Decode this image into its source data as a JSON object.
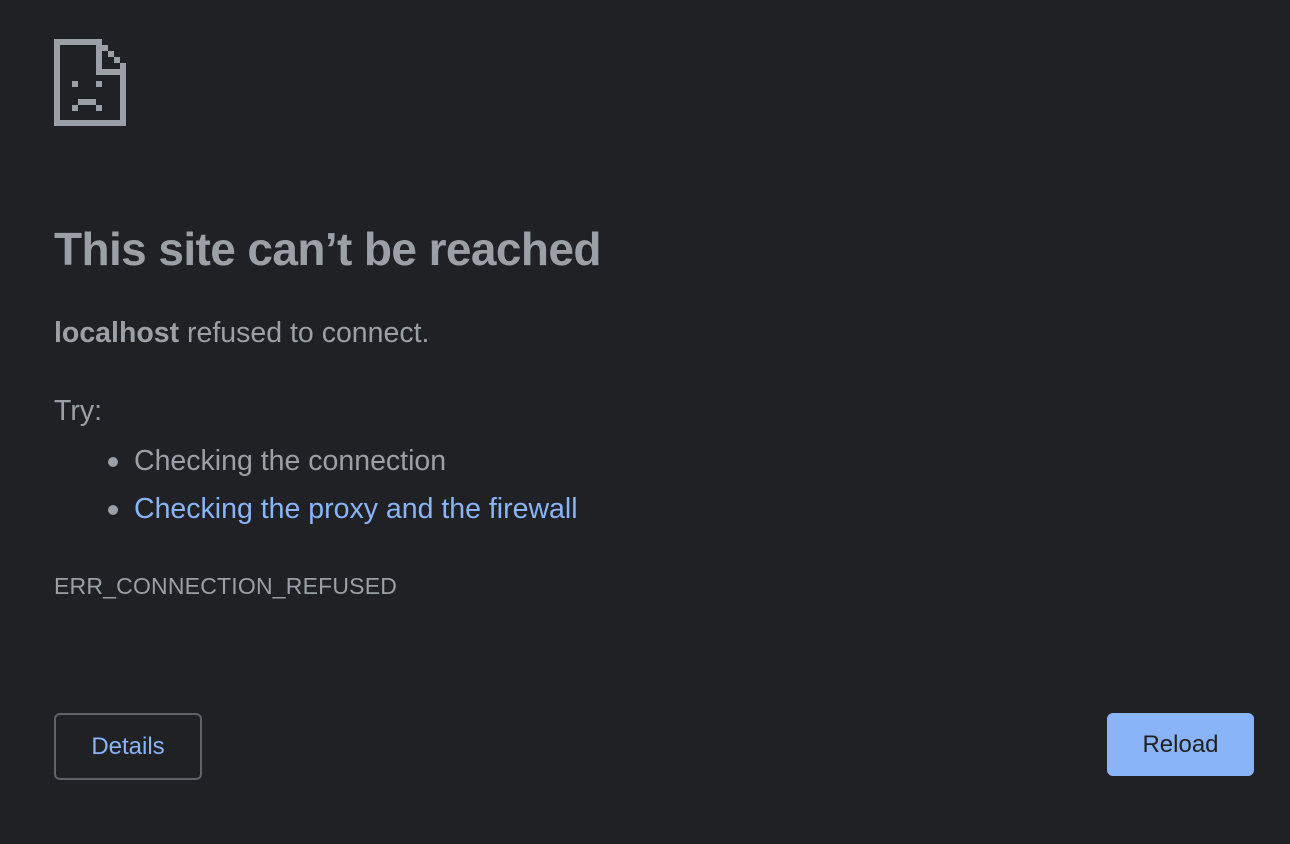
{
  "page": {
    "title": "This site can’t be reached",
    "host": "localhost",
    "summary_rest": " refused to connect.",
    "try_label": "Try:",
    "suggestions": [
      {
        "text": "Checking the connection",
        "is_link": false
      },
      {
        "text": "Checking the proxy and the firewall",
        "is_link": true
      }
    ],
    "error_code": "ERR_CONNECTION_REFUSED"
  },
  "buttons": {
    "details_label": "Details",
    "reload_label": "Reload"
  },
  "icon": {
    "name": "sad-page-icon"
  },
  "colors": {
    "background": "#202124",
    "text": "#9aa0a6",
    "link": "#8ab4f8",
    "primary_button": "#8ab4f8",
    "button_border": "#5f6368"
  }
}
